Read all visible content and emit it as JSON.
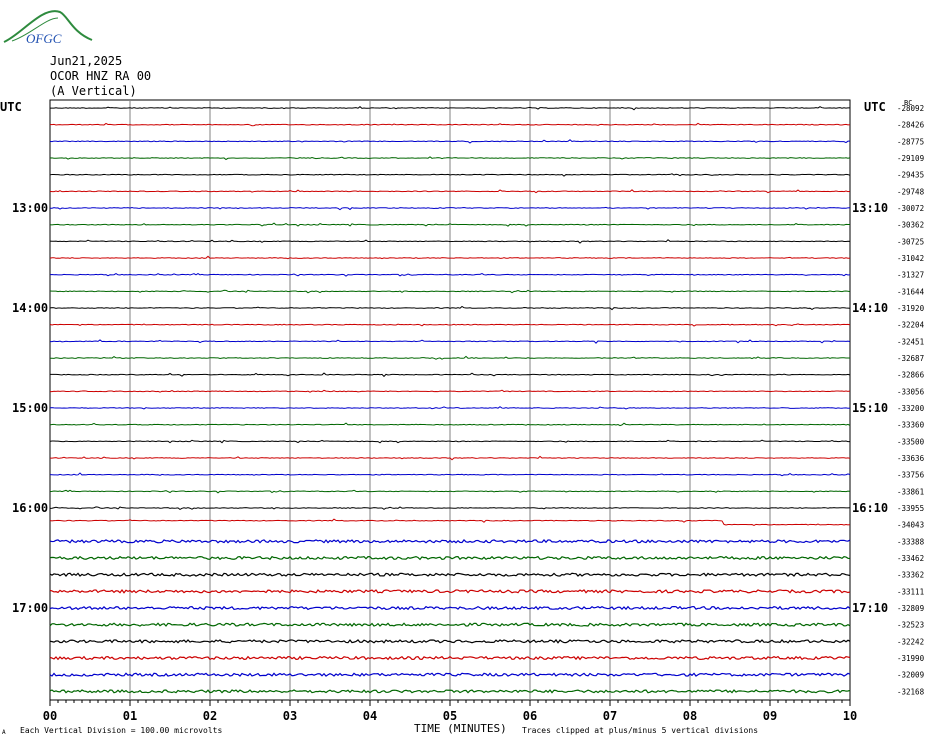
{
  "logo": {
    "text": "OFGC",
    "colors": {
      "text": "#1f4fb0",
      "swoosh": "#2e8b3e"
    }
  },
  "header": {
    "date": "Jun21,2025",
    "station": "OCOR HNZ RA 00",
    "component": "(A Vertical)"
  },
  "left_axis_label": "UTC",
  "right_axis_label": "UTC",
  "footer": {
    "scale": "Each Vertical Division =  100.00 microvolts",
    "xaxis_title": "TIME (MINUTES)",
    "clip_note": "Traces clipped at plus/minus 5 vertical divisions",
    "corner_mark": "A"
  },
  "chart_data": {
    "type": "line",
    "title": "",
    "xlabel": "TIME (MINUTES)",
    "xlim": [
      0,
      10
    ],
    "x_ticks": [
      "00",
      "01",
      "02",
      "03",
      "04",
      "05",
      "06",
      "07",
      "08",
      "09",
      "10"
    ],
    "trace_colors": [
      "#000000",
      "#cc0000",
      "#0000cc",
      "#006600"
    ],
    "left_time_labels": [
      {
        "row": 6,
        "label": "13:00"
      },
      {
        "row": 12,
        "label": "14:00"
      },
      {
        "row": 18,
        "label": "15:00"
      },
      {
        "row": 24,
        "label": "16:00"
      },
      {
        "row": 30,
        "label": "17:00"
      }
    ],
    "right_time_labels": [
      {
        "row": 6,
        "label": "13:10"
      },
      {
        "row": 12,
        "label": "14:10"
      },
      {
        "row": 18,
        "label": "15:10"
      },
      {
        "row": 24,
        "label": "16:10"
      },
      {
        "row": 30,
        "label": "17:10"
      }
    ],
    "offsets": [
      "-28092",
      "-28426",
      "-28775",
      "-29109",
      "-29435",
      "-29748",
      "-30072",
      "-30362",
      "-30725",
      "-31042",
      "-31327",
      "-31644",
      "-31920",
      "-32204",
      "-32451",
      "-32687",
      "-32866",
      "-33056",
      "-33200",
      "-33360",
      "-33500",
      "-33636",
      "-33756",
      "-33861",
      "-33955",
      "-34043",
      "-33388",
      "-33462",
      "-33362",
      "-33111",
      "-32809",
      "-32523",
      "-32242",
      "-31990",
      "-32009",
      "-32168"
    ],
    "top_right_mark": "BC",
    "trace_count": 36,
    "step_event": {
      "row": 25,
      "minute": 8.42
    }
  }
}
